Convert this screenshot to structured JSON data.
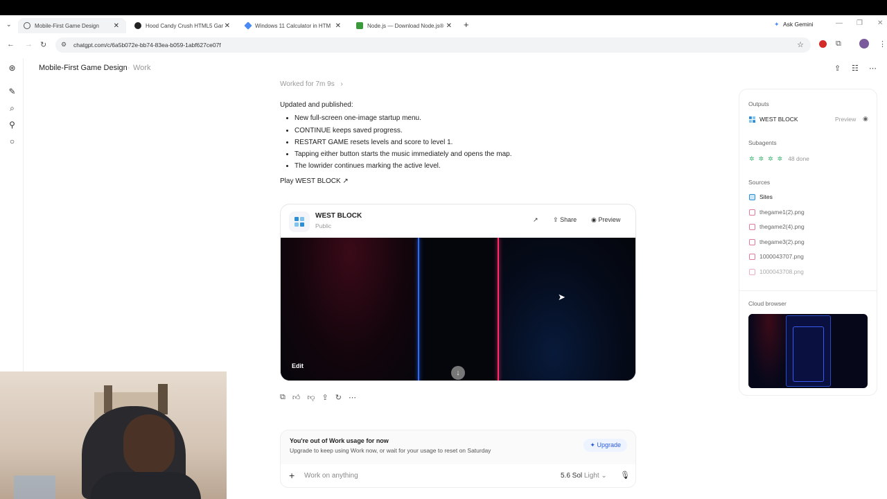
{
  "browser": {
    "tabs": [
      {
        "title": "Mobile-First Game Design",
        "active": true,
        "icon": "openai-icon"
      },
      {
        "title": "Hood Candy Crush HTML5 Gam",
        "active": false,
        "icon": "github-icon"
      },
      {
        "title": "Windows 11 Calculator in HTM",
        "active": false,
        "icon": "gemini-icon"
      },
      {
        "title": "Node.js — Download Node.js®",
        "active": false,
        "icon": "nodejs-icon"
      }
    ],
    "ask_gemini": "Ask Gemini",
    "url": "chatgpt.com/c/6a5b072e-bb74-83ea-b059-1abf627ce07f"
  },
  "app": {
    "title": "Mobile-First Game Design",
    "crumb": "Work"
  },
  "conversation": {
    "worked_for": "Worked for 7m 9s",
    "intro": "Updated and published:",
    "bullets": [
      "New full-screen one-image startup menu.",
      "CONTINUE keeps saved progress.",
      "RESTART GAME resets levels and score to level 1.",
      "Tapping either button starts the music immediately and opens the map.",
      "The lowrider continues marking the active level."
    ],
    "play_link": "Play WEST BLOCK ↗"
  },
  "card": {
    "title": "WEST BLOCK",
    "visibility": "Public",
    "share": "Share",
    "preview": "Preview",
    "edit": "Edit"
  },
  "usage": {
    "title": "You're out of Work usage for now",
    "body": "Upgrade to keep using Work now, or wait for your usage to reset on Saturday",
    "upgrade": "Upgrade"
  },
  "composer": {
    "placeholder": "Work on anything",
    "model": "5.6 Sol",
    "mode": "Light"
  },
  "side_panel": {
    "outputs_label": "Outputs",
    "output_item": "WEST BLOCK",
    "output_action": "Preview",
    "subagents_label": "Subagents",
    "subagents_status": "48 done",
    "sources_label": "Sources",
    "sources": [
      "Sites",
      "thegame1(2).png",
      "thegame2(4).png",
      "thegame3(2).png",
      "1000043707.png",
      "1000043708.png"
    ],
    "cloud_label": "Cloud browser"
  },
  "colors": {
    "accent_blue": "#2b6cff",
    "accent_red": "#ff2d6a",
    "link_blue": "#2a5bd7"
  }
}
